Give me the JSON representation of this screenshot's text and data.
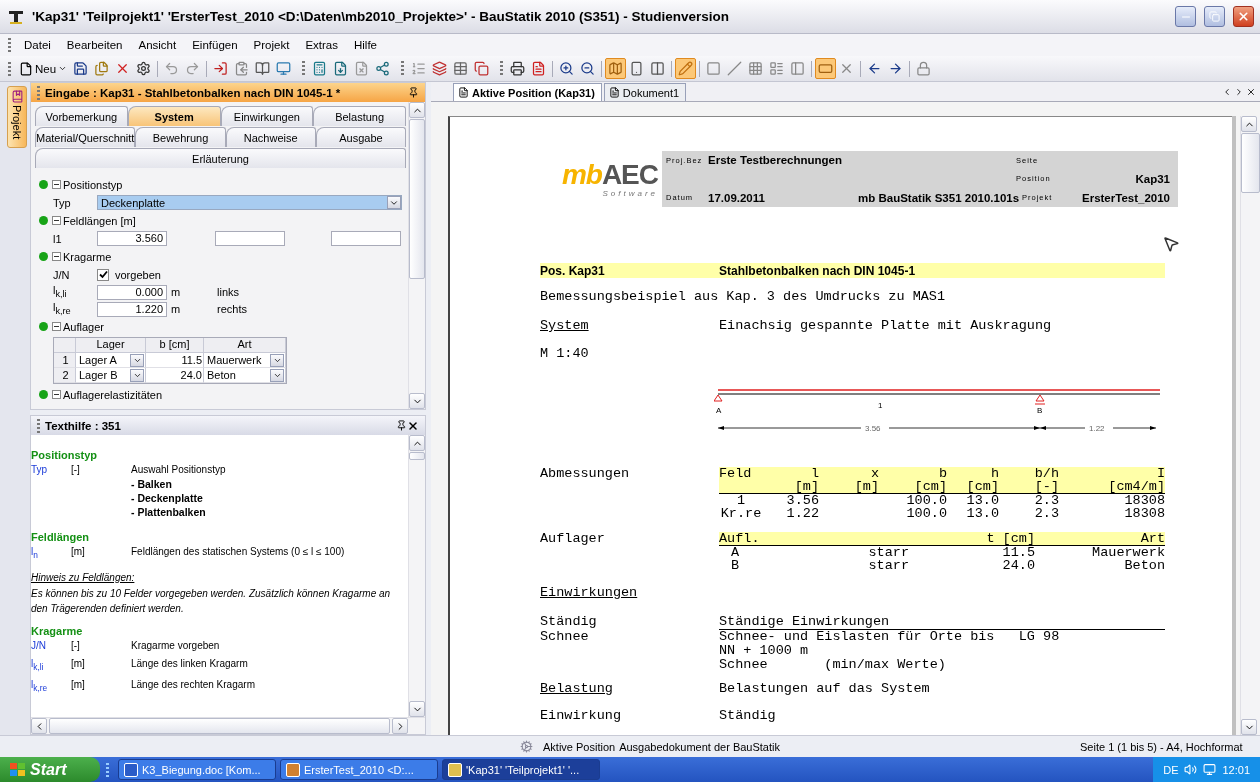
{
  "window": {
    "title": "'Kap31' 'Teilprojekt1' 'ErsterTest_2010 <D:\\Daten\\mb2010_Projekte>' - BauStatik 2010 (S351) - Studienversion"
  },
  "menu": [
    "Datei",
    "Bearbeiten",
    "Ansicht",
    "Einfügen",
    "Projekt",
    "Extras",
    "Hilfe"
  ],
  "toolbar": [
    {
      "kind": "new",
      "label": "Neu"
    },
    {
      "kind": "button",
      "pressed": false
    },
    {
      "kind": "button",
      "pressed": false
    },
    {
      "kind": "button",
      "pressed": false
    },
    {
      "kind": "button",
      "pressed": false
    },
    {
      "kind": "separator"
    },
    {
      "kind": "button",
      "pressed": false
    },
    {
      "kind": "button",
      "pressed": false
    },
    {
      "kind": "separator"
    },
    {
      "kind": "button",
      "pressed": false
    },
    {
      "kind": "button",
      "pressed": false
    },
    {
      "kind": "button",
      "pressed": false
    },
    {
      "kind": "button",
      "pressed": false
    },
    {
      "kind": "group"
    },
    {
      "kind": "button",
      "pressed": false
    },
    {
      "kind": "button",
      "pressed": false
    },
    {
      "kind": "button",
      "pressed": false
    },
    {
      "kind": "button",
      "pressed": false
    },
    {
      "kind": "group"
    },
    {
      "kind": "button",
      "pressed": false
    },
    {
      "kind": "button",
      "pressed": false
    },
    {
      "kind": "button",
      "pressed": false
    },
    {
      "kind": "button",
      "pressed": false
    },
    {
      "kind": "group"
    },
    {
      "kind": "button",
      "pressed": false
    },
    {
      "kind": "button",
      "pressed": false
    },
    {
      "kind": "separator"
    },
    {
      "kind": "button",
      "pressed": false
    },
    {
      "kind": "button",
      "pressed": false
    },
    {
      "kind": "separator"
    },
    {
      "kind": "button",
      "pressed": true
    },
    {
      "kind": "button",
      "pressed": false
    },
    {
      "kind": "button",
      "pressed": false
    },
    {
      "kind": "separator"
    },
    {
      "kind": "button",
      "pressed": true
    },
    {
      "kind": "separator"
    },
    {
      "kind": "button",
      "pressed": false
    },
    {
      "kind": "button",
      "pressed": false
    },
    {
      "kind": "button",
      "pressed": false
    },
    {
      "kind": "button",
      "pressed": false
    },
    {
      "kind": "button",
      "pressed": false
    },
    {
      "kind": "separator"
    },
    {
      "kind": "button",
      "pressed": true
    },
    {
      "kind": "button",
      "pressed": false
    },
    {
      "kind": "separator"
    },
    {
      "kind": "button",
      "pressed": false
    },
    {
      "kind": "button",
      "pressed": false
    },
    {
      "kind": "separator"
    },
    {
      "kind": "button",
      "pressed": false
    }
  ],
  "side_tab": {
    "label": "Projekt"
  },
  "input_panel": {
    "title": "Eingabe : Kap31 - Stahlbetonbalken nach DIN 1045-1 *",
    "tab_rows": [
      {
        "tabs": [
          {
            "label": "Vorbemerkung",
            "selected": false
          },
          {
            "label": "System",
            "selected": true
          },
          {
            "label": "Einwirkungen",
            "selected": false
          },
          {
            "label": "Belastung",
            "selected": false
          }
        ]
      },
      {
        "tabs": [
          {
            "label": "Material/Querschnitt",
            "selected": false
          },
          {
            "label": "Bewehrung",
            "selected": false
          },
          {
            "label": "Nachweise",
            "selected": false
          },
          {
            "label": "Ausgabe",
            "selected": false
          }
        ]
      },
      {
        "tabs": [
          {
            "label": "Erläuterung",
            "selected": false
          }
        ]
      }
    ],
    "sections": [
      {
        "title": "Positionstyp",
        "expanded": true,
        "rows": [
          {
            "kind": "select",
            "label": "Typ",
            "value": "Deckenplatte"
          }
        ]
      },
      {
        "title": "Feldlängen [m]",
        "expanded": true,
        "rows": [
          {
            "kind": "inputs",
            "label": "l1",
            "value": "3.560"
          }
        ]
      },
      {
        "title": "Kragarme",
        "expanded": true,
        "rows": [
          {
            "kind": "check",
            "label": "J/N",
            "checked": true,
            "text": "vorgeben"
          },
          {
            "kind": "length",
            "label": "l$_{k,li}$",
            "value": "0.000",
            "unit": "m",
            "note": "links"
          },
          {
            "kind": "length",
            "label": "l$_{k,re}$",
            "value": "1.220",
            "unit": "m",
            "note": "rechts"
          }
        ]
      },
      {
        "title": "Auflager",
        "expanded": true,
        "rows": [
          {
            "kind": "table",
            "columns": [
              "Lager",
              "b [cm]",
              "Art"
            ],
            "rows": [
              {
                "index": "1",
                "lager": "Lager A",
                "b": "11.5",
                "art": "Mauerwerk"
              },
              {
                "index": "2",
                "lager": "Lager B",
                "b": "24.0",
                "art": "Beton"
              }
            ]
          }
        ]
      },
      {
        "title": "Auflagerelastizitäten",
        "expanded": true
      }
    ]
  },
  "help_panel": {
    "title": "Texthilfe : 351",
    "sections": [
      {
        "title": "Positionstyp",
        "rows": [
          {
            "symbol": "Typ",
            "unit": "[-]",
            "text": "Auswahl Positionstyp",
            "options": [
              "- Balken",
              "- Deckenplatte",
              "- Plattenbalken"
            ]
          }
        ]
      },
      {
        "title": "Feldlängen",
        "rows": [
          {
            "symbol": "l$_{n}$",
            "unit": "[m]",
            "text": "Feldlängen des statischen Systems (0 ≤ l ≤ 100)"
          }
        ],
        "note": {
          "heading": "Hinweis zu Feldlängen:",
          "text": "Es können bis zu 10 Felder vorgegeben werden. Zusätzlich können Kragarme an den Trägerenden definiert werden."
        }
      },
      {
        "title": "Kragarme",
        "rows": [
          {
            "symbol": "J/N",
            "unit": "[-]",
            "text": "Kragarme vorgeben"
          },
          {
            "symbol": "l$_{k,li}$",
            "unit": "[m]",
            "text": "Länge des linken Kragarm"
          },
          {
            "symbol": "l$_{k,re}$",
            "unit": "[m]",
            "text": "Länge des rechten Kragarm"
          }
        ]
      }
    ]
  },
  "document": {
    "tabs": [
      {
        "label": "Aktive Position (Kap31)",
        "selected": true
      },
      {
        "label": "Dokument1",
        "selected": false
      }
    ],
    "header": {
      "logo_left": "mb",
      "logo_right": "AEC",
      "logo_sub": "Software",
      "project_label": "Proj.Bez",
      "project_name": "Erste Testberechnungen",
      "page_label": "Seite",
      "position_label": "Position",
      "position": "Kap31",
      "date_label": "Datum",
      "date": "17.09.2011",
      "program": "mb BauStatik S351  2010.101s",
      "project_file_label": "Projekt",
      "project_file": "ErsterTest_2010"
    },
    "position_bar": {
      "pos": "Pos. Kap31",
      "title": "Stahlbetonbalken nach DIN 1045-1"
    },
    "description": "Bemessungsbeispiel aus Kap. 3 des Umdrucks zu MAS1",
    "system": {
      "heading": "System",
      "text": "Einachsig gespannte Platte mit Auskragung",
      "scale": "M 1:40"
    },
    "diagram": {
      "support_a": "A",
      "span": "1",
      "support_b": "B",
      "length_1": "3.56",
      "length_2": "1.22"
    },
    "dimensions": {
      "label": "Abmessungen",
      "columns": [
        {
          "name": "Feld"
        },
        {
          "name": "l",
          "unit": "[m]"
        },
        {
          "name": "x",
          "unit": "[m]"
        },
        {
          "name": "b",
          "unit": "[cm]"
        },
        {
          "name": "h",
          "unit": "[cm]"
        },
        {
          "name": "b/h",
          "unit": "[-]"
        },
        {
          "name": "I",
          "unit": "[cm4/m]"
        }
      ],
      "rows": [
        {
          "cells": [
            "1",
            "3.56",
            null,
            "100.0",
            "13.0",
            "2.3",
            "18308"
          ]
        },
        {
          "cells": [
            "Kr.re",
            "1.22",
            null,
            "100.0",
            "13.0",
            "2.3",
            "18308"
          ]
        }
      ]
    },
    "supports": {
      "label": "Auflager",
      "columns": [
        "Aufl.",
        null,
        "t [cm]",
        "Art"
      ],
      "rows": [
        {
          "cells": [
            "A",
            "starr",
            "11.5",
            "Mauerwerk"
          ]
        },
        {
          "cells": [
            "B",
            "starr",
            "24.0",
            "Beton"
          ]
        }
      ]
    },
    "actions": {
      "heading": "Einwirkungen",
      "rows": [
        {
          "label": "Ständig",
          "lines": [
            "Ständige Einwirkungen"
          ]
        },
        {
          "label": "Schnee",
          "lines": [
            "Schnee- und Eislasten für Orte bis   LG 98",
            "NN + 1000 m",
            "Schnee       (min/max Werte)"
          ]
        }
      ]
    },
    "loads": {
      "heading": "Belastung",
      "text": "Belastungen auf das System",
      "rows": [
        {
          "label": "Einwirkung",
          "text": "Ständig"
        }
      ]
    }
  },
  "status_bar": {
    "left": "Aktive Position",
    "center": "Ausgabedokument der BauStatik",
    "right": "Seite 1 (1 bis 5) - A4, Hochformat"
  },
  "taskbar": {
    "start": "Start",
    "tasks": [
      {
        "kind": "word",
        "label": "K3_Biegung.doc [Kom...",
        "selected": false
      },
      {
        "kind": "project",
        "label": "ErsterTest_2010 <D:...",
        "selected": false
      },
      {
        "kind": "app",
        "label": "'Kap31' 'Teilprojekt1' '...",
        "selected": true
      }
    ],
    "language": "DE",
    "clock": "12:01"
  }
}
